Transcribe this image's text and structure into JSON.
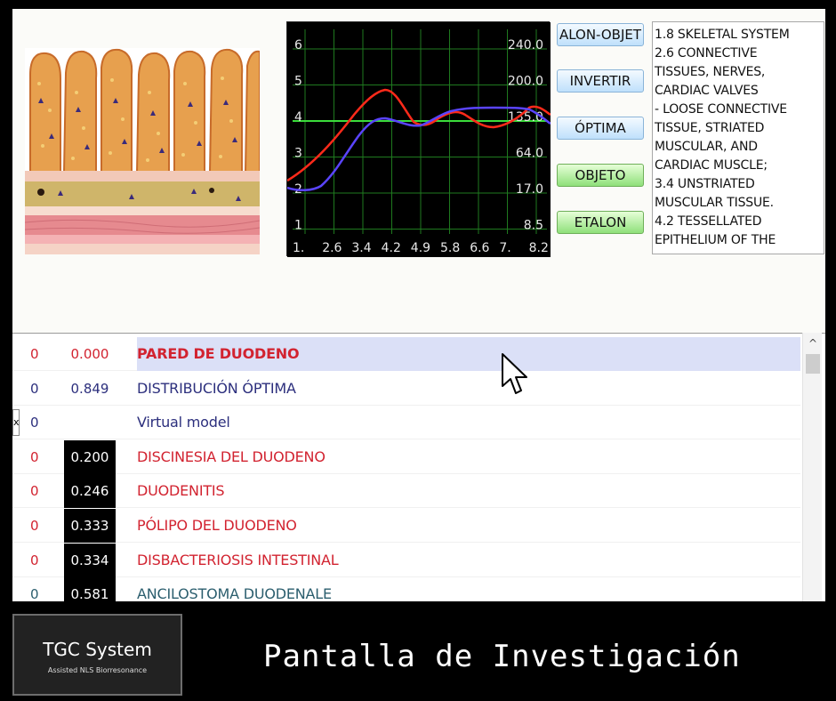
{
  "graph": {
    "left_ticks": [
      "6",
      "5",
      "4",
      "3",
      "2",
      "1"
    ],
    "right_ticks": [
      "240.0",
      "200.0",
      "135.0",
      "64.0",
      "17.0",
      "8.5"
    ],
    "bottom_ticks": [
      "1.",
      "2.6",
      "3.4",
      "4.2",
      "4.9",
      "5.8",
      "6.6",
      "7.",
      "8.2"
    ],
    "colors": {
      "background": "#000000",
      "grid": "#1f7a1f",
      "highlight": "#3bdc3b",
      "red_curve": "#ff2a1a",
      "blue_curve": "#5a44ff",
      "tick_text": "#e8e8e8"
    }
  },
  "buttons": {
    "etalon_objeto": "ALON-OBJET",
    "invertir": "INVERTIR",
    "optima": "ÓPTIMA",
    "objeto": "OBJETO",
    "etalon": "ETALON"
  },
  "info_lines": [
    "1.8 SKELETAL SYSTEM",
    "2.6 CONNECTIVE",
    "TISSUES, NERVES,",
    "CARDIAC VALVES",
    "- LOOSE CONNECTIVE",
    "TISSUE, STRIATED",
    "MUSCULAR, AND",
    "CARDIAC MUSCLE;",
    "3.4 UNSTRIATED",
    "MUSCULAR TISSUE.",
    "4.2 TESSELLATED",
    "EPITHELIUM OF THE"
  ],
  "rows": [
    {
      "col0": "0",
      "value": "0.000",
      "name": "PARED DE DUODENO"
    },
    {
      "col0": "0",
      "value": "0.849",
      "name": "DISTRIBUCIÓN ÓPTIMA"
    },
    {
      "col0": "0",
      "value": "",
      "name": "Virtual model"
    },
    {
      "col0": "0",
      "value": "0.200",
      "name": "DISCINESIA DEL DUODENO"
    },
    {
      "col0": "0",
      "value": "0.246",
      "name": "DUODENITIS"
    },
    {
      "col0": "0",
      "value": "0.333",
      "name": "PÓLIPO DEL DUODENO"
    },
    {
      "col0": "0",
      "value": "0.334",
      "name": "DISBACTERIOSIS INTESTINAL"
    },
    {
      "col0": "0",
      "value": "0.581",
      "name": "ANCILOSTOMA DUODENALE"
    }
  ],
  "edge_tab": "x",
  "scroll_up": "^",
  "logo": {
    "title": "TGC System",
    "subtitle": "Assisted NLS Biorresonance"
  },
  "footer_title": "Pantalla de Investigación"
}
